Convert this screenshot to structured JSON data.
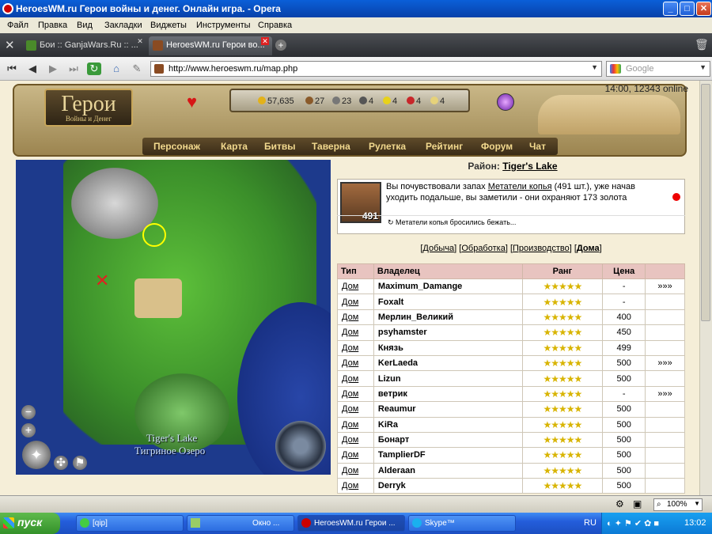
{
  "window": {
    "title": "HeroesWM.ru Герои войны и денег. Онлайн игра. - Opera"
  },
  "menu": [
    "Файл",
    "Правка",
    "Вид",
    "Закладки",
    "Виджеты",
    "Инструменты",
    "Справка"
  ],
  "tabs": [
    {
      "label": "Бои :: GanjaWars.Ru :: ..."
    },
    {
      "label": "HeroesWM.ru Герои во..."
    }
  ],
  "address": {
    "url": "http://www.heroeswm.ru/map.php",
    "search_placeholder": "Google"
  },
  "game": {
    "logo": "Герои",
    "logo_sub": "Войны и Денег",
    "online": "14:00, 12343 online",
    "resources": [
      "57,635",
      "27",
      "23",
      "4",
      "4",
      "4",
      "4"
    ],
    "nav": [
      "Персонаж",
      "Карта",
      "Битвы",
      "Таверна",
      "Рулетка",
      "Рейтинг",
      "Форум",
      "Чат"
    ]
  },
  "map": {
    "label_en": "Tiger's Lake",
    "label_ru": "Тигриное Озеро"
  },
  "district": {
    "label": "Район:",
    "name": "Tiger's Lake"
  },
  "event": {
    "count": "491",
    "text_pre": " Вы почувствовали запах ",
    "link": "Метатели копья",
    "text_post": " (491 шт.), уже начав уходить подальше, вы заметили - они охраняют 173 золота",
    "status": "Метатели копья бросились бежать..."
  },
  "subtabs": [
    "Добыча",
    "Обработка",
    "Производство",
    "Дома"
  ],
  "table": {
    "headers": [
      "Тип",
      "Владелец",
      "Ранг",
      "Цена",
      ""
    ],
    "rows": [
      {
        "type": "Дом",
        "owner": "Maximum_Damange",
        "rank": "★★★★★",
        "price": "-",
        "more": "»»»"
      },
      {
        "type": "Дом",
        "owner": "Foxalt",
        "rank": "★★★★★",
        "price": "-",
        "more": ""
      },
      {
        "type": "Дом",
        "owner": "Мерлин_Великий",
        "rank": "★★★★★",
        "price": "400",
        "more": ""
      },
      {
        "type": "Дом",
        "owner": "psyhamster",
        "rank": "★★★★★",
        "price": "450",
        "more": ""
      },
      {
        "type": "Дом",
        "owner": "Князь",
        "rank": "★★★★★",
        "price": "499",
        "more": ""
      },
      {
        "type": "Дом",
        "owner": "KerLaeda",
        "rank": "★★★★★",
        "price": "500",
        "more": "»»»"
      },
      {
        "type": "Дом",
        "owner": "Lizun",
        "rank": "★★★★★",
        "price": "500",
        "more": ""
      },
      {
        "type": "Дом",
        "owner": "ветрик",
        "rank": "★★★★★",
        "price": "-",
        "more": "»»»"
      },
      {
        "type": "Дом",
        "owner": "Reaumur",
        "rank": "★★★★★",
        "price": "500",
        "more": ""
      },
      {
        "type": "Дом",
        "owner": "KiRa",
        "rank": "★★★★★",
        "price": "500",
        "more": ""
      },
      {
        "type": "Дом",
        "owner": "Бонарт",
        "rank": "★★★★★",
        "price": "500",
        "more": ""
      },
      {
        "type": "Дом",
        "owner": "TamplierDF",
        "rank": "★★★★★",
        "price": "500",
        "more": ""
      },
      {
        "type": "Дом",
        "owner": "Alderaan",
        "rank": "★★★★★",
        "price": "500",
        "more": ""
      },
      {
        "type": "Дом",
        "owner": "Derryk",
        "rank": "★★★★★",
        "price": "500",
        "more": ""
      }
    ]
  },
  "statusbar": {
    "zoom": "100%"
  },
  "taskbar": {
    "start": "пуск",
    "tasks": [
      "[qip]",
      "Окно ...",
      "HeroesWM.ru Герои ...",
      "Skype™"
    ],
    "lang": "RU",
    "clock": "13:02"
  }
}
